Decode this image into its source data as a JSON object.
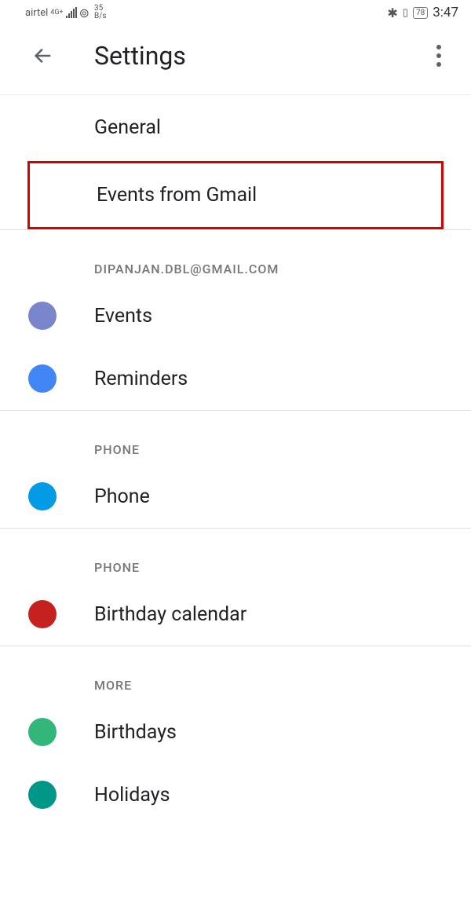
{
  "status": {
    "carrier": "airtel",
    "network": "4G+",
    "speed_top": "35",
    "speed_bottom": "B/s",
    "battery": "78",
    "time": "3:47"
  },
  "header": {
    "title": "Settings"
  },
  "items": {
    "general": "General",
    "events_gmail": "Events from Gmail"
  },
  "sections": [
    {
      "header": "DIPANJAN.DBL@GMAIL.COM",
      "items": [
        {
          "color": "#7986cb",
          "label": "Events"
        },
        {
          "color": "#4285f4",
          "label": "Reminders"
        }
      ]
    },
    {
      "header": "PHONE",
      "items": [
        {
          "color": "#039be5",
          "label": "Phone"
        }
      ]
    },
    {
      "header": "PHONE",
      "items": [
        {
          "color": "#c5221f",
          "label": "Birthday calendar"
        }
      ]
    },
    {
      "header": "MORE",
      "items": [
        {
          "color": "#33b679",
          "label": "Birthdays"
        },
        {
          "color": "#009688",
          "label": "Holidays"
        }
      ]
    }
  ]
}
